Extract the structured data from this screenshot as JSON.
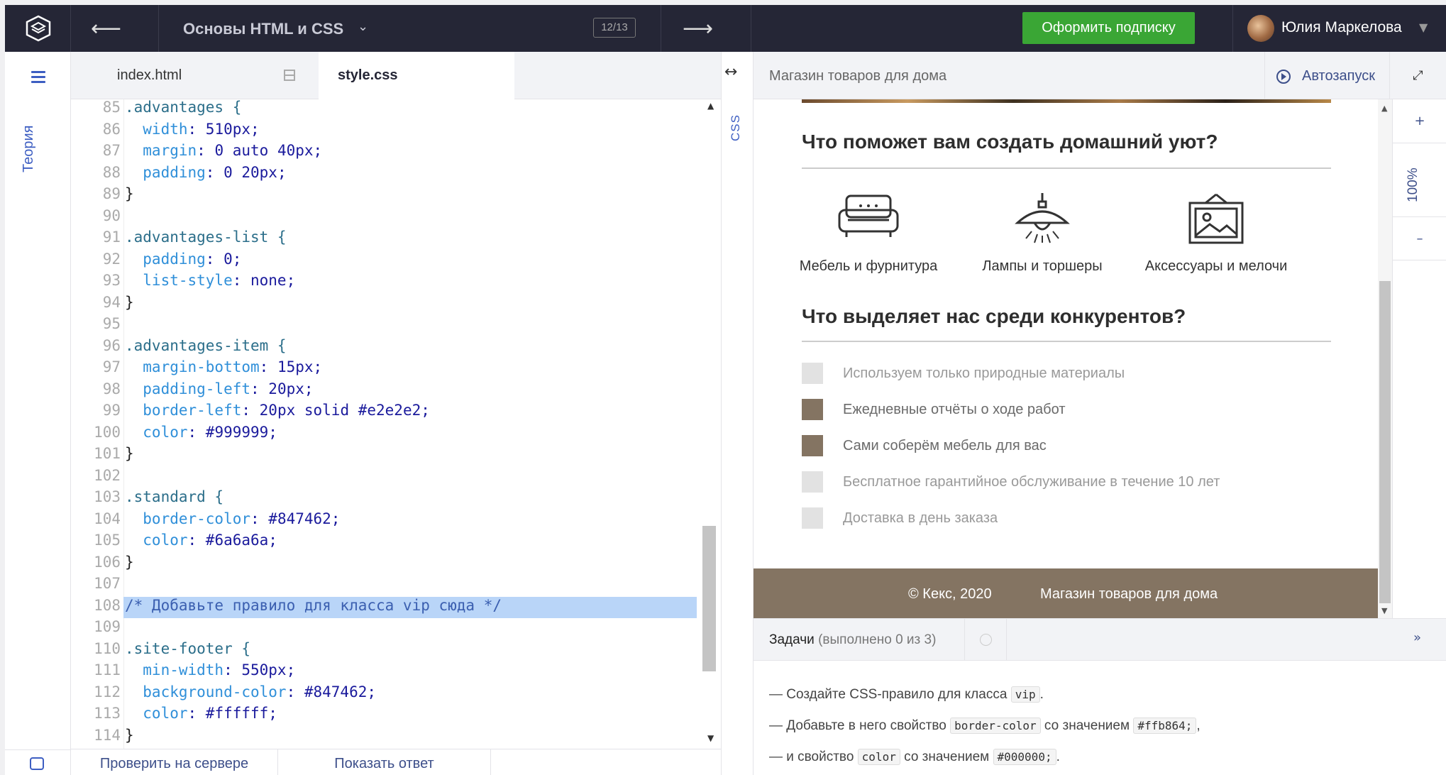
{
  "topbar": {
    "back_icon": "left-arrow",
    "course_title": "Основы HTML и CSS",
    "course_dropdown_icon": "chevron-down",
    "step_counter": "12/13",
    "forward_icon": "right-arrow",
    "subscribe_label": "Оформить подписку",
    "user_name": "Юлия Маркелова"
  },
  "rail": {
    "theory_label": "Теория"
  },
  "editor": {
    "tabs": [
      "index.html",
      "style.css"
    ],
    "active_tab": "style.css",
    "lines": [
      {
        "n": "85",
        "t": ".advantages {"
      },
      {
        "n": "86",
        "t": "  width: 510px;"
      },
      {
        "n": "87",
        "t": "  margin: 0 auto 40px;"
      },
      {
        "n": "88",
        "t": "  padding: 0 20px;"
      },
      {
        "n": "89",
        "t": "}"
      },
      {
        "n": "90",
        "t": ""
      },
      {
        "n": "91",
        "t": ".advantages-list {"
      },
      {
        "n": "92",
        "t": "  padding: 0;"
      },
      {
        "n": "93",
        "t": "  list-style: none;"
      },
      {
        "n": "94",
        "t": "}"
      },
      {
        "n": "95",
        "t": ""
      },
      {
        "n": "96",
        "t": ".advantages-item {"
      },
      {
        "n": "97",
        "t": "  margin-bottom: 15px;"
      },
      {
        "n": "98",
        "t": "  padding-left: 20px;"
      },
      {
        "n": "99",
        "t": "  border-left: 20px solid #e2e2e2;"
      },
      {
        "n": "100",
        "t": "  color: #999999;"
      },
      {
        "n": "101",
        "t": "}"
      },
      {
        "n": "102",
        "t": ""
      },
      {
        "n": "103",
        "t": ".standard {"
      },
      {
        "n": "104",
        "t": "  border-color: #847462;"
      },
      {
        "n": "105",
        "t": "  color: #6a6a6a;"
      },
      {
        "n": "106",
        "t": "}"
      },
      {
        "n": "107",
        "t": ""
      },
      {
        "n": "108",
        "t": "/* Добавьте правило для класса vip сюда */"
      },
      {
        "n": "109",
        "t": ""
      },
      {
        "n": "110",
        "t": ".site-footer {"
      },
      {
        "n": "111",
        "t": "  min-width: 550px;"
      },
      {
        "n": "112",
        "t": "  background-color: #847462;"
      },
      {
        "n": "113",
        "t": "  color: #ffffff;"
      },
      {
        "n": "114",
        "t": "}"
      }
    ],
    "highlighted_line": "108",
    "footer_buttons": [
      "Проверить на сервере",
      "Показать ответ"
    ],
    "side_label": "CSS"
  },
  "preview": {
    "title": "Магазин товаров для дома",
    "autorun_label": "Автозапуск",
    "zoom_level": "100%",
    "heading1": "Что поможет вам создать домашний уют?",
    "features": [
      {
        "icon": "sofa-icon",
        "label": "Мебель и фурнитура"
      },
      {
        "icon": "lamp-icon",
        "label": "Лампы и торшеры"
      },
      {
        "icon": "picture-icon",
        "label": "Аксессуары и мелочи"
      }
    ],
    "heading2": "Что выделяет нас среди конкурентов?",
    "advantages": [
      {
        "text": "Используем только природные материалы",
        "marker": "#e2e2e2",
        "color": "#999999"
      },
      {
        "text": "Ежедневные отчёты о ходе работ",
        "marker": "#847462",
        "color": "#6a6a6a"
      },
      {
        "text": "Сами соберём мебель для вас",
        "marker": "#847462",
        "color": "#6a6a6a"
      },
      {
        "text": "Бесплатное гарантийное обслуживание в течение 10 лет",
        "marker": "#e2e2e2",
        "color": "#999999"
      },
      {
        "text": "Доставка в день заказа",
        "marker": "#e2e2e2",
        "color": "#999999"
      }
    ],
    "footer_copy": "© Кекс, 2020",
    "footer_shop": "Магазин товаров для дома",
    "footer_bg": "#847462"
  },
  "tasks": {
    "title": "Задачи",
    "progress": "(выполнено 0 из 3)",
    "items": [
      {
        "parts": [
          "— Создайте CSS-правило для класса ",
          "vip",
          "."
        ]
      },
      {
        "parts": [
          "— Добавьте в него свойство ",
          "border-color",
          " со значением ",
          "#ffb864;",
          ","
        ]
      },
      {
        "parts": [
          "— и свойство ",
          "color",
          " со значением ",
          "#000000;",
          "."
        ]
      }
    ]
  }
}
